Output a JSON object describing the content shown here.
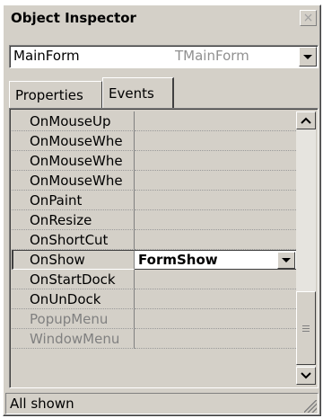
{
  "window": {
    "title": "Object Inspector",
    "close_glyph": "×"
  },
  "selector": {
    "name": "MainForm",
    "type": "TMainForm"
  },
  "tabs": [
    {
      "label": "Properties",
      "active": false
    },
    {
      "label": "Events",
      "active": true
    }
  ],
  "events": [
    {
      "name": "OnMouseUp",
      "value": ""
    },
    {
      "name": "OnMouseWhe",
      "value": ""
    },
    {
      "name": "OnMouseWhe",
      "value": ""
    },
    {
      "name": "OnMouseWhe",
      "value": ""
    },
    {
      "name": "OnPaint",
      "value": ""
    },
    {
      "name": "OnResize",
      "value": ""
    },
    {
      "name": "OnShortCut",
      "value": ""
    },
    {
      "name": "OnShow",
      "value": "FormShow",
      "selected": true
    },
    {
      "name": "OnStartDock",
      "value": ""
    },
    {
      "name": "OnUnDock",
      "value": ""
    },
    {
      "name": "PopupMenu",
      "value": "",
      "grey": true
    },
    {
      "name": "WindowMenu",
      "value": "",
      "grey": true
    }
  ],
  "status": {
    "text": "All shown"
  },
  "icons": {
    "scroll_up": "chevron-up-icon",
    "scroll_down": "chevron-down-icon",
    "dropdown": "triangle-down-icon",
    "close": "close-icon"
  }
}
